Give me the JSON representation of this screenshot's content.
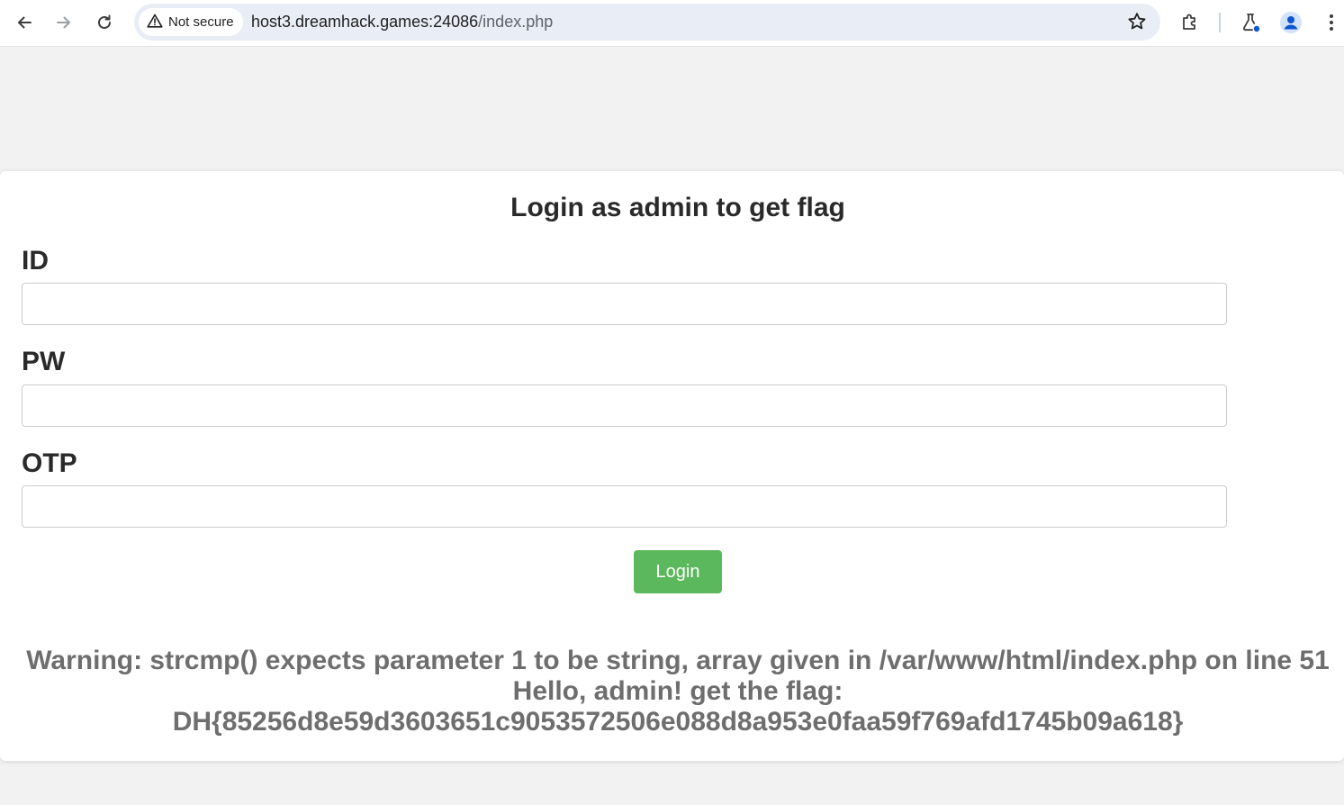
{
  "browser": {
    "security_label": "Not secure",
    "url_host": "host3.dreamhack.games:24086",
    "url_path": "/index.php",
    "icons": [
      "back-icon",
      "forward-icon",
      "reload-icon",
      "warning-icon",
      "star-icon",
      "extensions-icon",
      "labs-icon",
      "profile-icon",
      "menu-icon"
    ]
  },
  "form": {
    "title": "Login as admin to get flag",
    "id_label": "ID",
    "pw_label": "PW",
    "otp_label": "OTP",
    "id_value": "",
    "pw_value": "",
    "otp_value": "",
    "login_label": "Login"
  },
  "output": {
    "warning": "Warning: strcmp() expects parameter 1 to be string, array given in /var/www/html/index.php on line 51",
    "hello": "Hello, admin! get the flag:",
    "flag": "DH{85256d8e59d3603651c9053572506e088d8a953e0faa59f769afd1745b09a618}"
  },
  "colors": {
    "login_button": "#5cb85c",
    "message_text": "#6e6e6e",
    "page_background": "#f2f2f2",
    "omnibox_background": "#e9eef6"
  }
}
